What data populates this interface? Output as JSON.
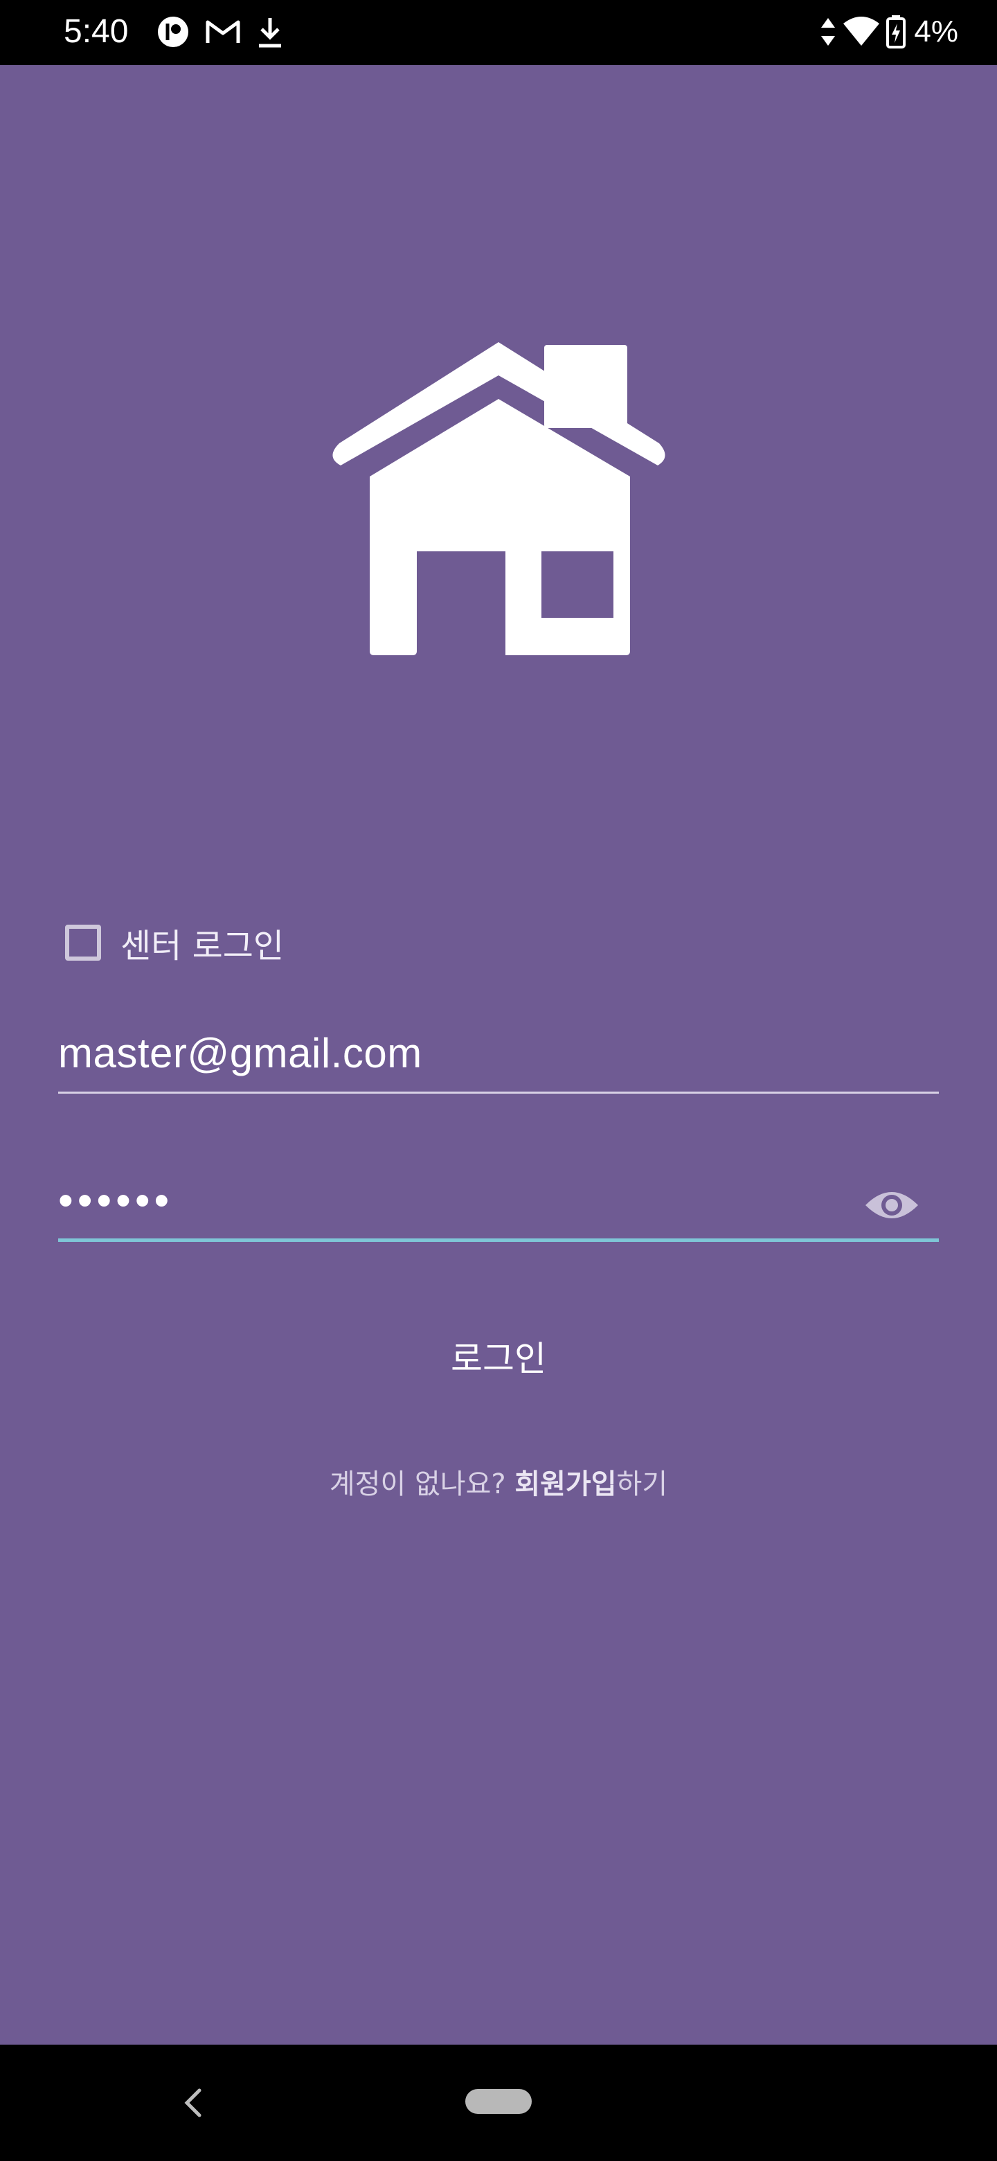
{
  "status_bar": {
    "time": "5:40",
    "battery": "4%",
    "icons_left": [
      "circle-app-icon",
      "gmail-icon",
      "download-icon"
    ],
    "icons_right": [
      "data-arrows-icon",
      "wifi-icon",
      "battery-icon"
    ]
  },
  "logo": {
    "icon": "house-icon"
  },
  "login_form": {
    "center_login_label": "센터 로그인",
    "center_login_checked": false,
    "email_value": "master@gmail.com",
    "password_value": "••••••",
    "show_password_icon": "eye-icon",
    "login_button_label": "로그인",
    "signup_prefix": "계정이 없나요? ",
    "signup_link": "회원가입",
    "signup_suffix": "하기"
  },
  "nav_bar": {
    "back_icon": "back-chevron-icon",
    "home_icon": "home-pill-icon"
  },
  "colors": {
    "background": "#6f5b93",
    "accent_underline": "#7fc6d7",
    "system_bars": "#000000"
  }
}
